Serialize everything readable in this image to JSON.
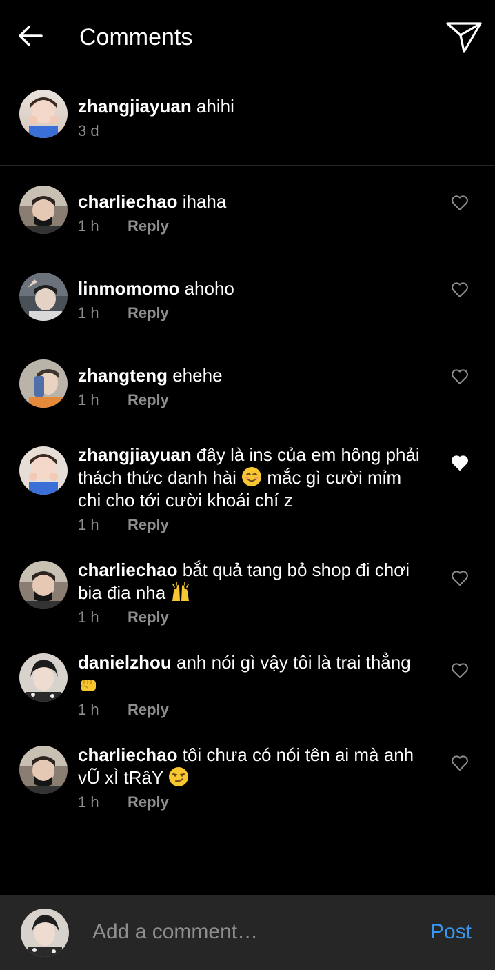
{
  "header": {
    "title": "Comments",
    "back_icon": "arrow-left-icon",
    "send_icon": "paper-plane-icon"
  },
  "caption": {
    "username": "zhangjiayuan",
    "text": " ahihi",
    "time": "3 d"
  },
  "comments": [
    {
      "username": "charliechao",
      "text": " ihaha",
      "time": "1 h",
      "reply_label": "Reply",
      "liked": false
    },
    {
      "username": "linmomomo",
      "text": " ahoho",
      "time": "1 h",
      "reply_label": "Reply",
      "liked": false
    },
    {
      "username": "zhangteng",
      "text": " ehehe",
      "time": "1 h",
      "reply_label": "Reply",
      "liked": false
    },
    {
      "username": "zhangjiayuan",
      "text": " đây là ins của em hông phải thách thức danh hài ",
      "emoji": "smiling-face-emoji",
      "text_after": " mắc gì cười mỉm chi cho tới cười khoái chí z",
      "time": "1 h",
      "reply_label": "Reply",
      "liked": true
    },
    {
      "username": "charliechao",
      "text": " bắt quả tang bỏ shop đi chơi bia đia nha ",
      "emoji": "raising-hands-emoji",
      "text_after": "",
      "time": "1 h",
      "reply_label": "Reply",
      "liked": false
    },
    {
      "username": "danielzhou",
      "text": " anh nói gì vậy tôi là trai thẳng ",
      "emoji": "fist-emoji",
      "text_after": "",
      "time": "1 h",
      "reply_label": "Reply",
      "liked": false
    },
    {
      "username": "charliechao",
      "text": " tôi chưa có nói tên ai mà anh vŨ xÌ tRâY ",
      "emoji": "smirk-emoji",
      "text_after": "",
      "time": "1 h",
      "reply_label": "Reply",
      "liked": false
    }
  ],
  "composer": {
    "placeholder": "Add a comment…",
    "post_label": "Post"
  },
  "colors": {
    "background": "#000000",
    "secondary_text": "#8e8e8e",
    "composer_bg": "#262626",
    "post_blue": "#3897f0",
    "liked_heart": "#ffffff"
  }
}
